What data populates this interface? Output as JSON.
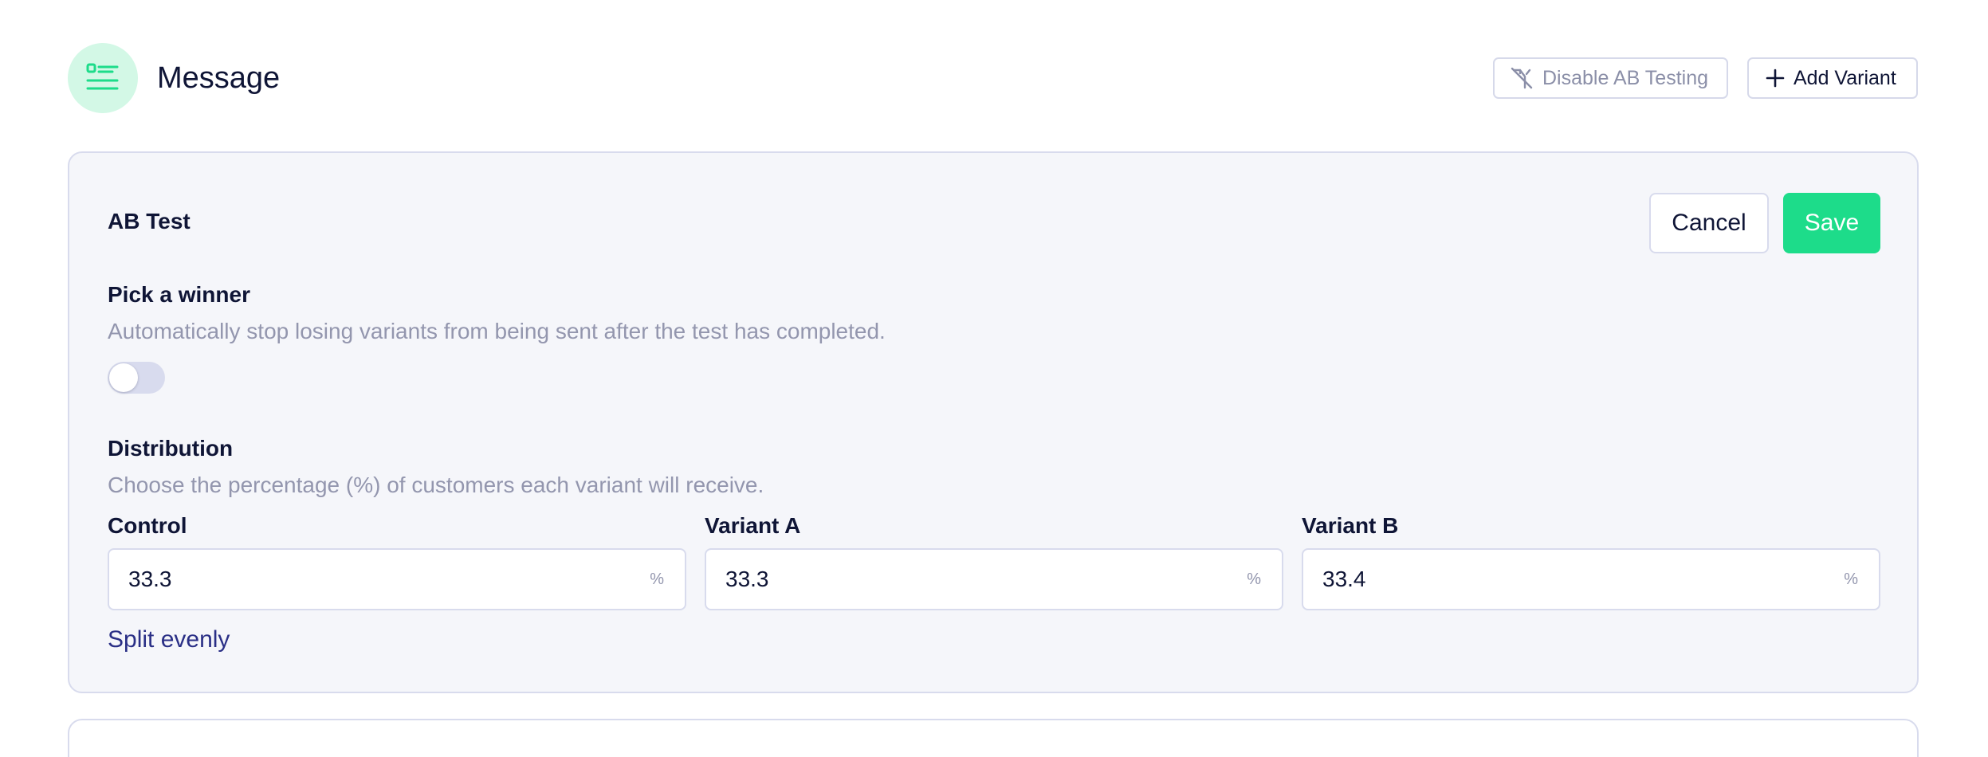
{
  "header": {
    "title": "Message",
    "icon": "list-icon",
    "disable_ab_label": "Disable AB Testing",
    "add_variant_label": "Add Variant"
  },
  "ab_test": {
    "title": "AB Test",
    "cancel_label": "Cancel",
    "save_label": "Save",
    "pick_winner": {
      "label": "Pick a winner",
      "description": "Automatically stop losing variants from being sent after the test has completed.",
      "enabled": false
    },
    "distribution": {
      "label": "Distribution",
      "description": "Choose the percentage (%) of customers each variant will receive.",
      "fields": [
        {
          "label": "Control",
          "value": "33.3",
          "suffix": "%"
        },
        {
          "label": "Variant A",
          "value": "33.3",
          "suffix": "%"
        },
        {
          "label": "Variant B",
          "value": "33.4",
          "suffix": "%"
        }
      ],
      "split_evenly_label": "Split evenly"
    }
  },
  "colors": {
    "accent": "#1ddc8a",
    "icon_bg": "#d3f8e6",
    "card_bg": "#f5f6fa",
    "link": "#2a2f86",
    "muted_text": "#9396ae"
  }
}
